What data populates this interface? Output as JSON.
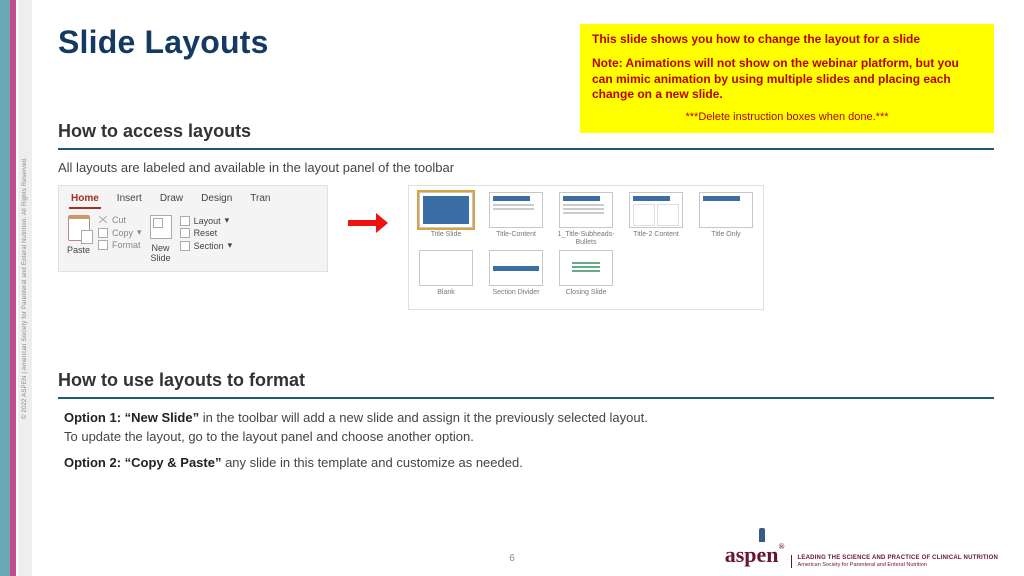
{
  "title": "Slide Layouts",
  "copyright": "© 2022 ASPEN | American Society for Parenteral and Enteral Nutrition. All Rights Reserved.",
  "yellow": {
    "line1": "This slide shows you how to change the layout for a slide",
    "line2": "Note:  Animations will not show on the webinar platform, but you can mimic animation by using multiple slides and placing each change on a new slide.",
    "line3": "***Delete instruction boxes when done.***"
  },
  "section1": {
    "heading": "How to access layouts",
    "body": "All layouts are labeled and available in the layout panel of the toolbar"
  },
  "ribbon": {
    "tabs": [
      "Home",
      "Insert",
      "Draw",
      "Design",
      "Tran"
    ],
    "paste": "Paste",
    "cut": "Cut",
    "copy": "Copy",
    "format": "Format",
    "newslide": "New\nSlide",
    "layout": "Layout",
    "reset": "Reset",
    "section": "Section"
  },
  "gallery": {
    "row1": [
      "Title Slide",
      "Title-Content",
      "1_Title-Subheads-Bullets",
      "Title-2 Content",
      "Title Only"
    ],
    "row2": [
      "Blank",
      "Section Divider",
      "Closing Slide"
    ]
  },
  "section2": {
    "heading": "How to use layouts to format",
    "opt1_bold": "Option 1: “New Slide”",
    "opt1_rest": " in the toolbar will add a new slide and assign it the previously selected layout.",
    "opt1_line2": "To update the layout, go to the layout panel and choose another option.",
    "opt2_bold": "Option 2: “Copy & Paste”",
    "opt2_rest": " any slide in this template and customize as needed."
  },
  "page_number": "6",
  "logo": {
    "word": "aspen",
    "reg": "®",
    "l1": "LEADING THE SCIENCE AND PRACTICE OF CLINICAL NUTRITION",
    "l2": "American Society for Parenteral and Enteral Nutrition"
  }
}
